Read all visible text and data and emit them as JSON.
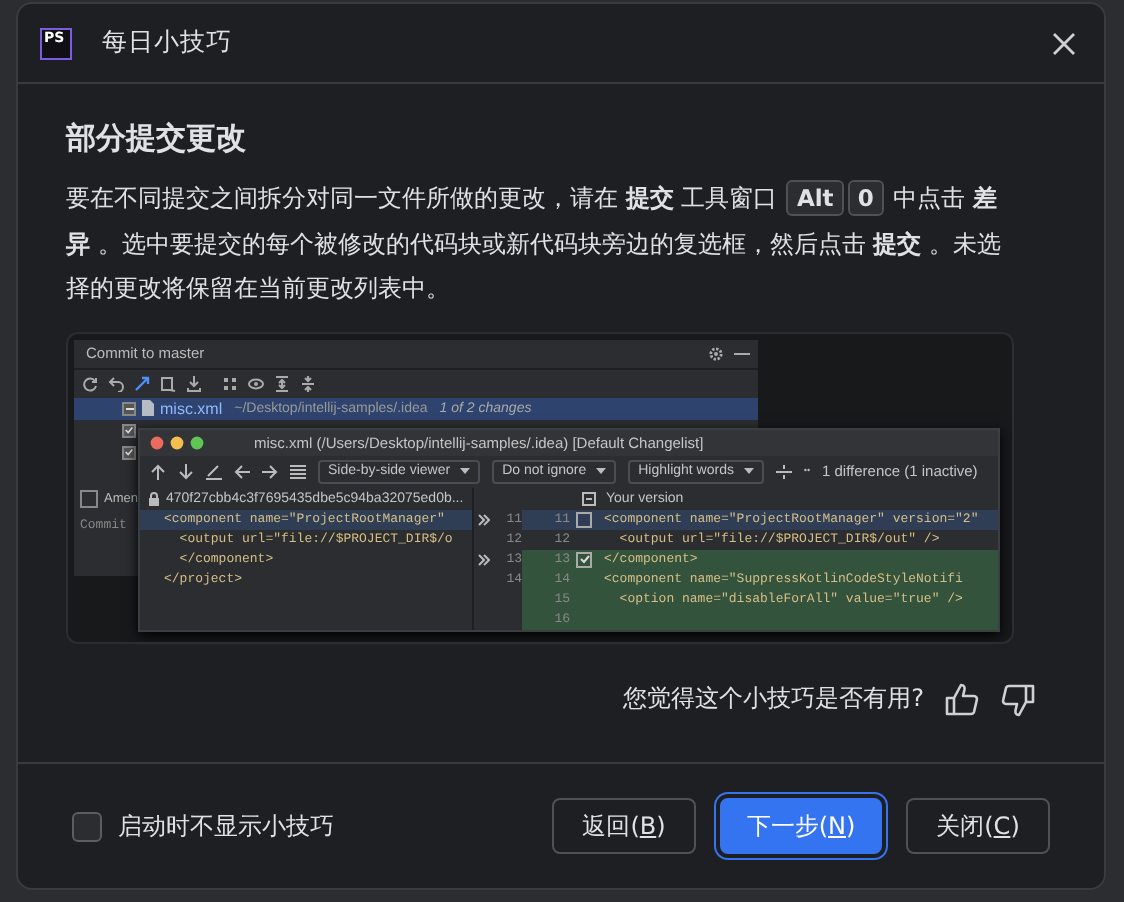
{
  "dialog": {
    "logo_text": "PS",
    "title": "每日小技巧"
  },
  "tip": {
    "heading": "部分提交更改",
    "paragraph": [
      {
        "kind": "text",
        "text": "要在不同提交之间拆分对同一文件所做的更改，请在 **提交** 工具窗口 "
      },
      {
        "kind": "key",
        "text": "Alt"
      },
      {
        "kind": "key",
        "text": "0"
      },
      {
        "kind": "text",
        "text": " 中点击 **差异** 。选中要提交的每个被修改的代码块或新代码块旁边的复选框，然后点击 **提交** 。未选择的更改将保留在当前更改列表中。"
      }
    ]
  },
  "illustration": {
    "commit_window": {
      "tab": "Commit to master",
      "rows": [
        {
          "name": "misc.xml",
          "path": "~/Desktop/intellij-samples/.idea",
          "note": "1 of 2 changes",
          "checked": true,
          "partial": true,
          "selected": true
        },
        {
          "checked": true,
          "partial": false,
          "selected": false
        },
        {
          "checked": true,
          "partial": false,
          "selected": false
        }
      ],
      "amend_label": "Amen",
      "amend_checked": false,
      "message_placeholder": "Commit"
    },
    "diff_window": {
      "title": "misc.xml (/Users/Desktop/intellij-samples/.idea) [Default Changelist]",
      "viewer": "Side-by-side viewer",
      "ignore": "Do not ignore",
      "highlight": "Highlight words",
      "summary": "1 difference (1 inactive)",
      "left_header": "470f27cbb4c3f7695435dbe5c94ba32075ed0b...",
      "right_header": "Your version",
      "left_lines": [
        {
          "text": "<component name=\"ProjectRootManager\"",
          "kind": "selected"
        },
        {
          "text": "  <output url=\"file://$PROJECT_DIR$/o",
          "kind": "plain"
        },
        {
          "text": "  </component>",
          "kind": "plain"
        },
        {
          "text": "</project>",
          "kind": "plain"
        }
      ],
      "gutter": [
        {
          "left_number": "11",
          "right_number": "11",
          "arrow": true,
          "has_checkbox": true,
          "checked": false
        },
        {
          "left_number": "12",
          "right_number": "12",
          "arrow": false,
          "has_checkbox": false
        },
        {
          "left_number": "13",
          "right_number": "13",
          "arrow": true,
          "has_checkbox": true,
          "checked": true
        },
        {
          "left_number": "14",
          "right_number": "14",
          "arrow": false,
          "has_checkbox": false
        },
        {
          "right_number": "15",
          "arrow": false,
          "has_checkbox": false
        },
        {
          "right_number": "16",
          "arrow": false,
          "has_checkbox": false
        }
      ],
      "right_lines": [
        {
          "text": "<component name=\"ProjectRootManager\" version=\"2\"",
          "kind": "selected"
        },
        {
          "text": "  <output url=\"file://$PROJECT_DIR$/out\" />",
          "kind": "plain"
        },
        {
          "text": "</component>",
          "kind": "inserted"
        },
        {
          "text": "<component name=\"SuppressKotlinCodeStyleNotifi",
          "kind": "inserted"
        },
        {
          "text": "  <option name=\"disableForAll\" value=\"true\" />",
          "kind": "inserted"
        },
        {
          "kind": "inserted"
        }
      ]
    }
  },
  "feedback": {
    "question": "您觉得这个小技巧是否有用?"
  },
  "footer": {
    "dont_show": {
      "label": "启动时不显示小技巧",
      "checked": false
    },
    "buttons": [
      {
        "label_before": "返回(",
        "mnemonic": "B",
        "label_after": ")",
        "primary": false
      },
      {
        "label_before": "下一步(",
        "mnemonic": "N",
        "label_after": ")",
        "primary": true
      },
      {
        "label_before": "关闭(",
        "mnemonic": "C",
        "label_after": ")",
        "primary": false
      }
    ]
  }
}
